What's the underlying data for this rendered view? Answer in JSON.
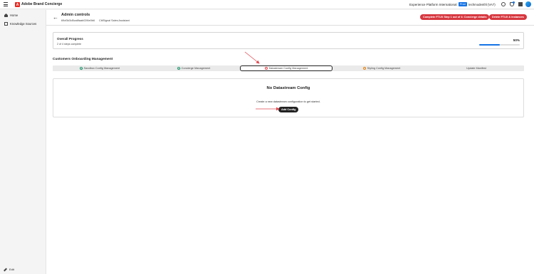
{
  "app": {
    "title": "Adobe Brand Concierge",
    "logo_letter": "A",
    "org_name": "Experience Platform International",
    "env_badge": "Prod",
    "sandbox": "techmodenthl (VA7)"
  },
  "sidebar": {
    "items": [
      {
        "label": "Home",
        "icon": "home-icon"
      },
      {
        "label": "Knowledge Sources",
        "icon": "database-icon"
      }
    ],
    "edit_label": "Edit"
  },
  "header": {
    "title": "Admin controls",
    "id": "69cf3d3d5ca6faab02f4e0b6",
    "name": "CitiSignal Sales Assistant",
    "complete_button": "Complete FTUX Step 1 out of 4: Concierge details",
    "delete_button": "Delete FTUX & instances"
  },
  "progress": {
    "title": "Overall Progress",
    "subtitle": "2 of 4 steps complete",
    "percent_label": "50%",
    "value": 0.5
  },
  "section": {
    "title": "Customers Onboarding Management"
  },
  "steps": [
    {
      "label": "Sandbox Config Management",
      "status": "done"
    },
    {
      "label": "Concierge Management",
      "status": "done"
    },
    {
      "label": "Datastream Config Management",
      "status": "error"
    },
    {
      "label": "Styling Config Management",
      "status": "warning"
    },
    {
      "label": "Update Manifest",
      "status": "none"
    }
  ],
  "empty_state": {
    "title": "No Datastream Config",
    "text": "Create a new datastream configuration to get started.",
    "button": "Add Config"
  },
  "colors": {
    "accent": "#1473e6",
    "danger": "#d7373f",
    "success": "#2d9d78",
    "warning": "#e68619",
    "annotation": "#e34850"
  }
}
